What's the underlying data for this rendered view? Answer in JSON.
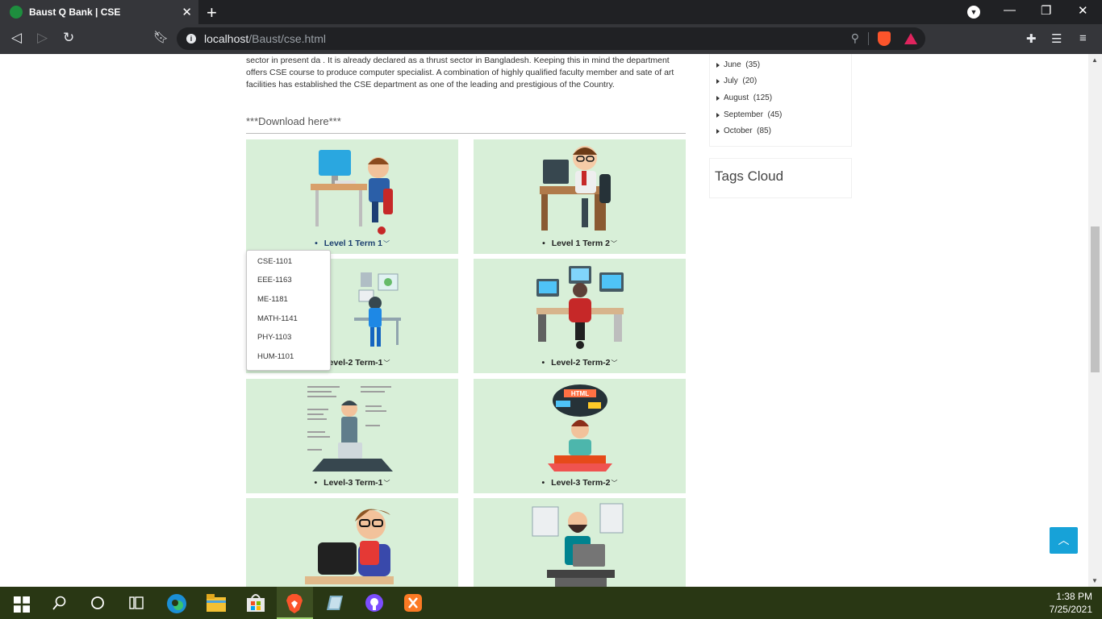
{
  "browser": {
    "tab_title": "Baust Q Bank | CSE",
    "tab_close": "✕",
    "new_tab": "+",
    "url_host": "localhost",
    "url_path": "/Baust/cse.html"
  },
  "page": {
    "intro_text": "sector in present da . It is already declared as a thrust sector in Bangladesh. Keeping this in mind the department offers CSE course to produce computer specialist. A combination of highly qualified faculty member and sate of art facilities has established the CSE department as one of the leading and prestigious of the Country.",
    "download_heading": "***Download here***",
    "cards": [
      {
        "label": "Level 1 Term 1"
      },
      {
        "label": "Level 1 Term 2"
      },
      {
        "label": "Level-2 Term-1"
      },
      {
        "label": "Level-2 Term-2"
      },
      {
        "label": "Level-3 Term-1"
      },
      {
        "label": "Level-3 Term-2"
      }
    ],
    "dropdown": [
      "CSE-1101",
      "EEE-1163",
      "ME-1181",
      "MATH-1141",
      "PHY-1103",
      "HUM-1101"
    ]
  },
  "sidebar": {
    "archives": [
      {
        "month": "June",
        "count": "(35)"
      },
      {
        "month": "July",
        "count": "(20)"
      },
      {
        "month": "August",
        "count": "(125)"
      },
      {
        "month": "September",
        "count": "(45)"
      },
      {
        "month": "October",
        "count": "(85)"
      }
    ],
    "tags_title": "Tags Cloud"
  },
  "taskbar": {
    "time": "1:38 PM",
    "date": "7/25/2021"
  },
  "colors": {
    "card_bg": "#d8efd8",
    "accent": "#17a2d8",
    "taskbar": "#293714"
  }
}
